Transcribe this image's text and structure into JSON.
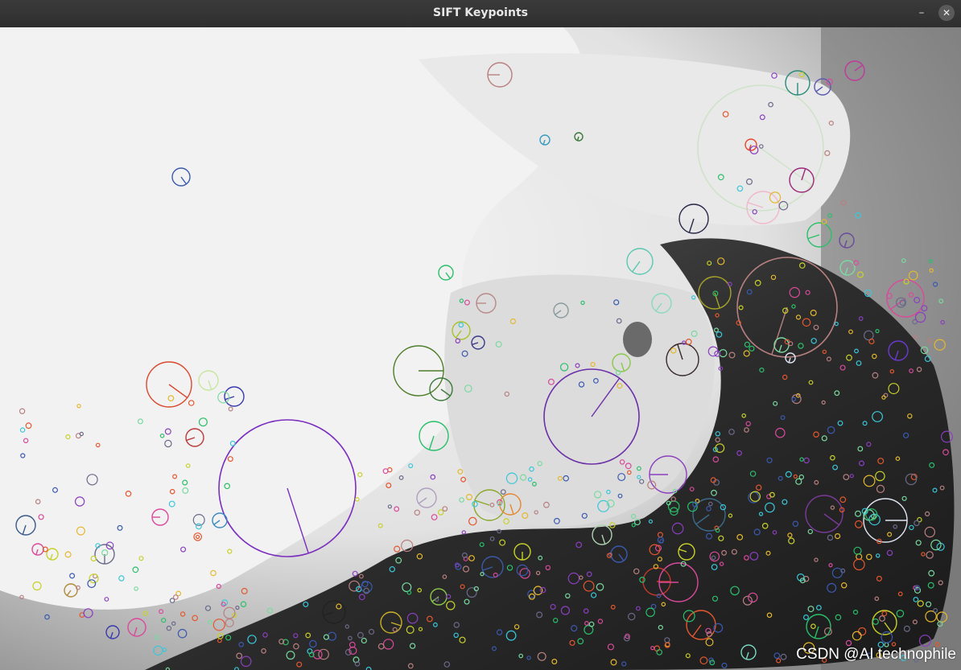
{
  "window": {
    "title": "SIFT Keypoints",
    "minimize_glyph": "–",
    "close_glyph": "✕"
  },
  "image": {
    "watermark": "CSDN @AI technophile"
  },
  "colors": {
    "titlebar": "#2f2f2f",
    "title_text": "#e8e8e8"
  },
  "icons": [
    "minimize-icon",
    "close-icon"
  ]
}
